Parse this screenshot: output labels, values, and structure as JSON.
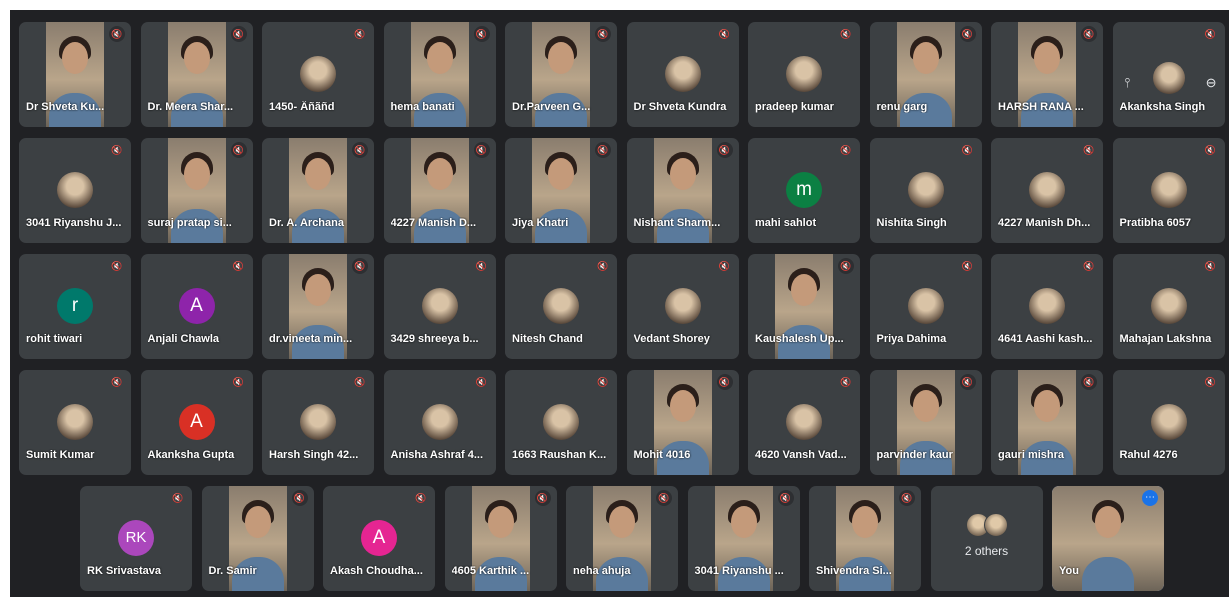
{
  "colors": {
    "tile_background": "#3c4043",
    "stage_background": "#202124",
    "active_outline": "#8ab4f8",
    "more_button": "#1a73e8"
  },
  "icons": {
    "mute": "mic-off-icon",
    "pin": "pin-icon",
    "remove": "remove-icon",
    "more": "more-options-icon"
  },
  "rows": [
    [
      {
        "name": "Dr Shveta Ku...",
        "kind": "video"
      },
      {
        "name": "Dr. Meera Shar...",
        "kind": "video"
      },
      {
        "name": "1450- Âñãñd",
        "kind": "photo"
      },
      {
        "name": "hema banati",
        "kind": "video"
      },
      {
        "name": "Dr.Parveen G...",
        "kind": "video"
      },
      {
        "name": "Dr Shveta Kundra",
        "kind": "photo"
      },
      {
        "name": "pradeep kumar",
        "kind": "photo"
      },
      {
        "name": "renu garg",
        "kind": "video"
      },
      {
        "name": "HARSH RANA ...",
        "kind": "video"
      },
      {
        "name": "Akanksha Singh",
        "kind": "pinned"
      }
    ],
    [
      {
        "name": "3041 Riyanshu J...",
        "kind": "photo"
      },
      {
        "name": "suraj pratap si...",
        "kind": "video"
      },
      {
        "name": "Dr. A. Archana",
        "kind": "video"
      },
      {
        "name": "4227 Manish D...",
        "kind": "video"
      },
      {
        "name": "Jiya Khatri",
        "kind": "video"
      },
      {
        "name": "Nishant Sharm...",
        "kind": "video"
      },
      {
        "name": "mahi sahlot",
        "kind": "letter",
        "letter": "m",
        "color": "#0b8043"
      },
      {
        "name": "Nishita Singh",
        "kind": "photo"
      },
      {
        "name": "4227 Manish Dh...",
        "kind": "photo"
      },
      {
        "name": "Pratibha 6057",
        "kind": "photo"
      }
    ],
    [
      {
        "name": "rohit tiwari",
        "kind": "letter",
        "letter": "r",
        "color": "#00796b"
      },
      {
        "name": "Anjali Chawla",
        "kind": "letter",
        "letter": "A",
        "color": "#8e24aa"
      },
      {
        "name": "dr.vineeta min...",
        "kind": "video"
      },
      {
        "name": "3429 shreeya b...",
        "kind": "photo"
      },
      {
        "name": "Nitesh Chand",
        "kind": "photo"
      },
      {
        "name": "Vedant Shorey",
        "kind": "photo"
      },
      {
        "name": "Kaushalesh Up...",
        "kind": "video"
      },
      {
        "name": "Priya Dahima",
        "kind": "photo"
      },
      {
        "name": "4641 Aashi kash...",
        "kind": "photo"
      },
      {
        "name": "Mahajan Lakshna",
        "kind": "photo"
      }
    ],
    [
      {
        "name": "Sumit Kumar",
        "kind": "photo"
      },
      {
        "name": "Akanksha Gupta",
        "kind": "letter",
        "letter": "A",
        "color": "#d93025"
      },
      {
        "name": "Harsh Singh 42...",
        "kind": "photo"
      },
      {
        "name": "Anisha Ashraf 4...",
        "kind": "photo"
      },
      {
        "name": "1663 Raushan K...",
        "kind": "photo"
      },
      {
        "name": "Mohit 4016",
        "kind": "video"
      },
      {
        "name": "4620 Vansh Vad...",
        "kind": "photo"
      },
      {
        "name": "parvinder kaur",
        "kind": "video"
      },
      {
        "name": "gauri mishra",
        "kind": "video"
      },
      {
        "name": "Rahul 4276",
        "kind": "photo"
      }
    ],
    [
      {
        "name": "RK Srivastava",
        "kind": "letter",
        "letter": "RK",
        "color": "#ab47bc"
      },
      {
        "name": "Dr. Samir",
        "kind": "video"
      },
      {
        "name": "Akash Choudha...",
        "kind": "letter",
        "letter": "A",
        "color": "#e52592"
      },
      {
        "name": "4605 Karthik ...",
        "kind": "video"
      },
      {
        "name": "neha ahuja",
        "kind": "video"
      },
      {
        "name": "3041 Riyanshu ...",
        "kind": "video"
      },
      {
        "name": "Shivendra Si...",
        "kind": "video"
      },
      {
        "name": "",
        "kind": "others",
        "label": "2 others"
      },
      {
        "name": "You",
        "kind": "self"
      }
    ]
  ]
}
